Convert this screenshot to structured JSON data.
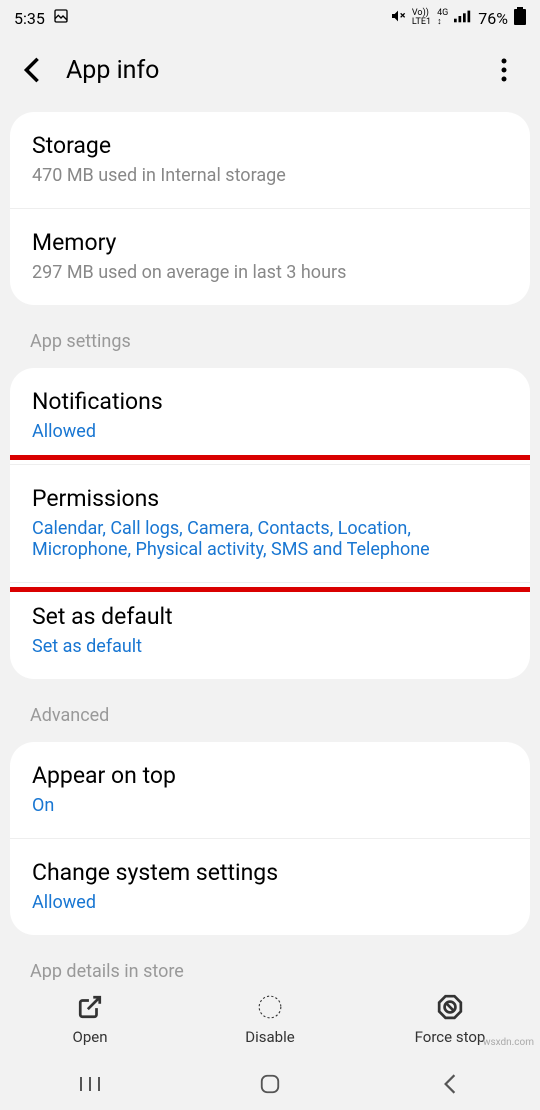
{
  "status": {
    "time": "5:35",
    "battery": "76%"
  },
  "header": {
    "title": "App info"
  },
  "usage": [
    {
      "title": "Storage",
      "sub": "470 MB used in Internal storage"
    },
    {
      "title": "Memory",
      "sub": "297 MB used on average in last 3 hours"
    }
  ],
  "app_settings_header": "App settings",
  "app_settings": [
    {
      "title": "Notifications",
      "sub": "Allowed"
    },
    {
      "title": "Permissions",
      "sub": "Calendar, Call logs, Camera, Contacts, Location, Microphone, Physical activity, SMS and Telephone"
    },
    {
      "title": "Set as default",
      "sub": "Set as default"
    }
  ],
  "advanced_header": "Advanced",
  "advanced": [
    {
      "title": "Appear on top",
      "sub": "On"
    },
    {
      "title": "Change system settings",
      "sub": "Allowed"
    }
  ],
  "details_header": "App details in store",
  "actions": {
    "open": "Open",
    "disable": "Disable",
    "force_stop": "Force stop"
  },
  "watermark": "wsxdn.com"
}
